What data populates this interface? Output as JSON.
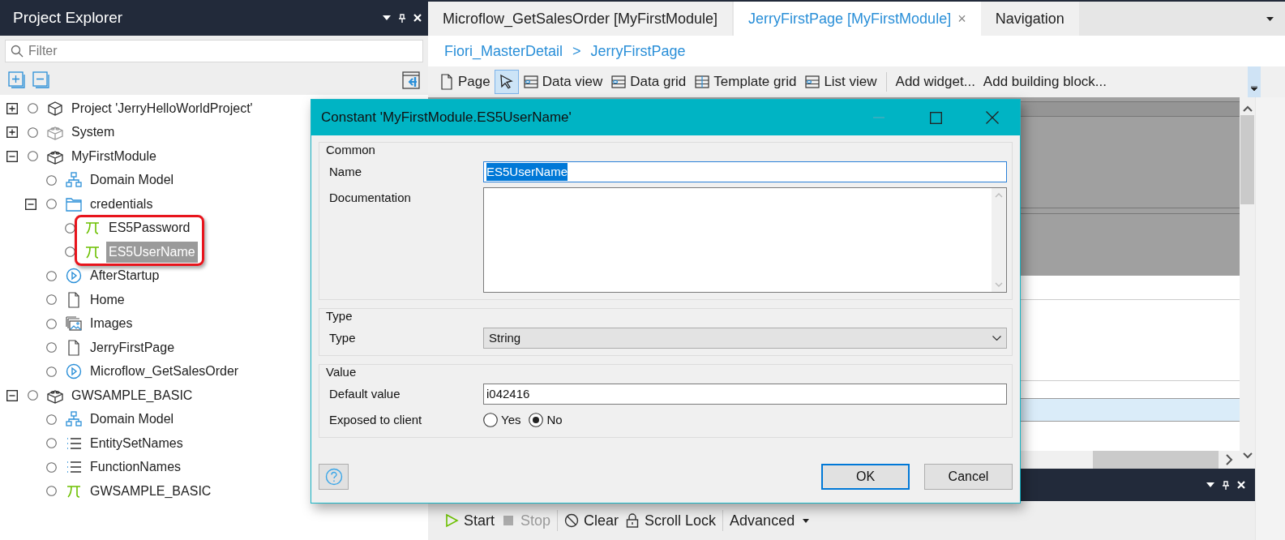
{
  "explorer": {
    "title": "Project Explorer",
    "filter_placeholder": "Filter",
    "tree": [
      {
        "label": "Project 'JerryHelloWorldProject'",
        "kind": "project",
        "expanded": false,
        "selected": false
      },
      {
        "label": "System",
        "kind": "system",
        "expanded": false,
        "selected": false
      },
      {
        "label": "MyFirstModule",
        "kind": "module",
        "expanded": true,
        "selected": false,
        "children": [
          {
            "label": "Domain Model",
            "kind": "domain-model",
            "selected": false
          },
          {
            "label": "credentials",
            "kind": "folder",
            "expanded": true,
            "selected": false,
            "framed": true,
            "children": [
              {
                "label": "ES5Password",
                "kind": "constant",
                "selected": false
              },
              {
                "label": "ES5UserName",
                "kind": "constant",
                "selected": true
              }
            ]
          },
          {
            "label": "AfterStartup",
            "kind": "microflow",
            "selected": false
          },
          {
            "label": "Home",
            "kind": "page",
            "selected": false
          },
          {
            "label": "Images",
            "kind": "images",
            "selected": false
          },
          {
            "label": "JerryFirstPage",
            "kind": "page",
            "selected": false
          },
          {
            "label": "Microflow_GetSalesOrder",
            "kind": "microflow",
            "selected": false
          }
        ]
      },
      {
        "label": "GWSAMPLE_BASIC",
        "kind": "module",
        "expanded": true,
        "selected": false,
        "children": [
          {
            "label": "Domain Model",
            "kind": "domain-model",
            "selected": false
          },
          {
            "label": "EntitySetNames",
            "kind": "enumeration",
            "selected": false
          },
          {
            "label": "FunctionNames",
            "kind": "enumeration",
            "selected": false
          },
          {
            "label": "GWSAMPLE_BASIC",
            "kind": "constant",
            "selected": false
          }
        ]
      }
    ]
  },
  "editor": {
    "tabs": [
      {
        "label": "Microflow_GetSalesOrder [MyFirstModule]",
        "selected": false,
        "closable": false
      },
      {
        "label": "JerryFirstPage [MyFirstModule]",
        "selected": true,
        "closable": true
      },
      {
        "label": "Navigation",
        "selected": false,
        "closable": false
      }
    ],
    "close_glyph": "×",
    "breadcrumb": [
      "Fiori_MasterDetail",
      "JerryFirstPage"
    ],
    "breadcrumb_separator": ">",
    "toolbar": [
      {
        "kind": "page",
        "label": "Page",
        "selected": false
      },
      {
        "kind": "pointer",
        "selected": true
      },
      {
        "kind": "data-view",
        "label": "Data view",
        "selected": false
      },
      {
        "kind": "data-grid",
        "label": "Data grid",
        "selected": false
      },
      {
        "kind": "template-grid",
        "label": "Template grid",
        "selected": false
      },
      {
        "kind": "list-view",
        "label": "List view",
        "selected": false
      },
      {
        "kind": "separator"
      },
      {
        "kind": "text",
        "label": "Add widget...",
        "selected": false
      },
      {
        "kind": "text",
        "label": "Add building block...",
        "selected": false
      }
    ]
  },
  "console": {
    "toolbar": [
      {
        "kind": "start",
        "label": "Start",
        "disabled": false
      },
      {
        "kind": "stop",
        "label": "Stop",
        "disabled": true
      },
      {
        "kind": "separator"
      },
      {
        "kind": "clear",
        "label": "Clear",
        "disabled": false
      },
      {
        "kind": "scroll-lock",
        "label": "Scroll Lock",
        "disabled": false
      },
      {
        "kind": "separator"
      },
      {
        "kind": "menu",
        "label": "Advanced",
        "disabled": false
      }
    ]
  },
  "dialog": {
    "title": "Constant 'MyFirstModule.ES5UserName'",
    "groups": [
      {
        "legend": "Common",
        "fields": [
          {
            "kind": "text",
            "label": "Name",
            "value": "ES5UserName",
            "focused": true
          },
          {
            "kind": "textarea",
            "label": "Documentation"
          }
        ]
      },
      {
        "legend": "Type",
        "fields": [
          {
            "kind": "select",
            "label": "Type",
            "value": "String"
          }
        ]
      },
      {
        "legend": "Value",
        "fields": [
          {
            "kind": "text",
            "label": "Default value",
            "value": "i042416",
            "focused": false
          },
          {
            "kind": "radio",
            "label": "Exposed to client",
            "options": [
              {
                "label": "Yes",
                "selected": false
              },
              {
                "label": "No",
                "selected": true
              }
            ]
          }
        ]
      }
    ],
    "buttons": [
      {
        "label": "OK",
        "default": true
      },
      {
        "label": "Cancel",
        "default": false
      }
    ]
  }
}
